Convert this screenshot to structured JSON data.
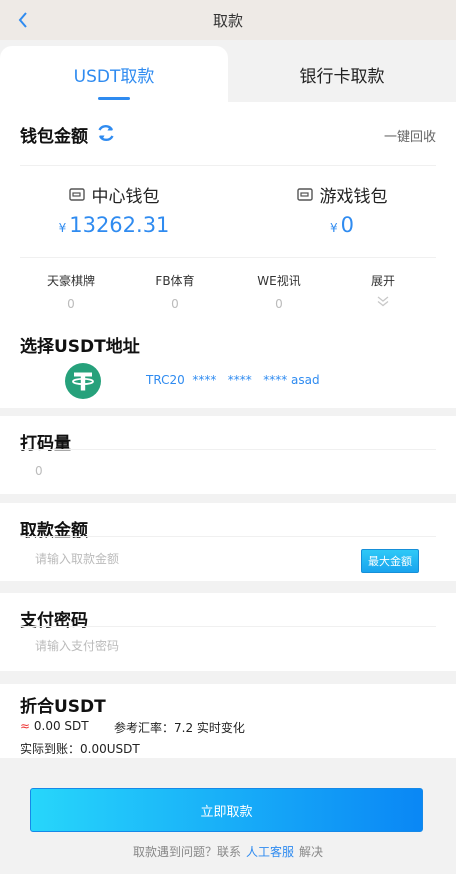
{
  "header": {
    "title": "取款"
  },
  "tabs": [
    {
      "label": "USDT取款"
    },
    {
      "label": "银行卡取款"
    }
  ],
  "wallet": {
    "title": "钱包金额",
    "recycle": "一键回收",
    "center": {
      "name": "中心钱包",
      "currency": "¥",
      "amount": "13262.31"
    },
    "game": {
      "name": "游戏钱包",
      "currency": "¥",
      "amount": "0"
    },
    "platforms": [
      {
        "name": "天豪棋牌",
        "value": "0"
      },
      {
        "name": "FB体育",
        "value": "0"
      },
      {
        "name": "WE视讯",
        "value": "0"
      },
      {
        "name": "展开"
      }
    ]
  },
  "usdt_address": {
    "title": "选择USDT地址",
    "address": "TRC20  ****   ****   **** asad"
  },
  "turnover": {
    "title": "打码量",
    "value": "0"
  },
  "amount": {
    "title": "取款金额",
    "placeholder": "请输入取款金额",
    "max_label": "最大金额"
  },
  "password": {
    "title": "支付密码",
    "placeholder": "请输入支付密码"
  },
  "convert": {
    "title": "折合USDT",
    "approx_symbol": "≈",
    "usdt_value": " 0.00 SDT",
    "rate_text": "参考汇率：7.2 实时变化",
    "actual": "实际到账：0.00USDT"
  },
  "submit": {
    "label": "立即取款"
  },
  "help": {
    "prefix": "取款遇到问题？联系",
    "link": "人工客服",
    "suffix": "解决"
  },
  "colors": {
    "accent": "#2f8bf0",
    "tether": "#26a17b"
  }
}
